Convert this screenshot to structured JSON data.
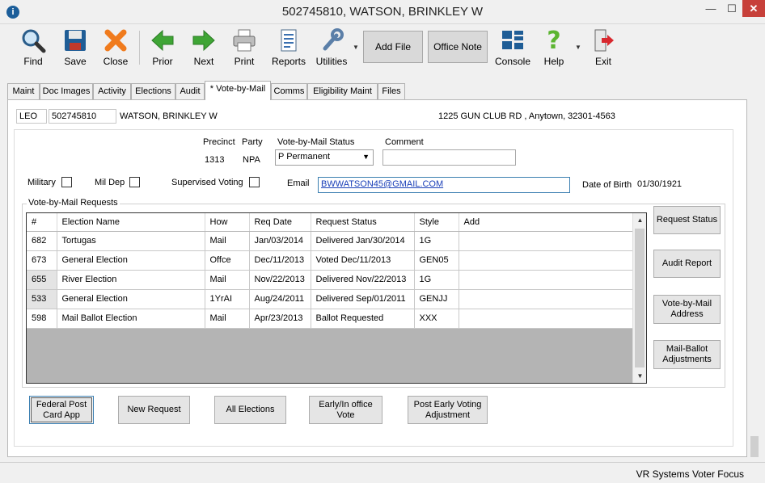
{
  "window": {
    "title": "502745810, WATSON, BRINKLEY W",
    "min": "—",
    "max": "☐",
    "close": "✕"
  },
  "toolbar": {
    "find": "Find",
    "save": "Save",
    "close": "Close",
    "prior": "Prior",
    "next": "Next",
    "print": "Print",
    "reports": "Reports",
    "utilities": "Utilities",
    "add_file": "Add File",
    "office_note": "Office Note",
    "console": "Console",
    "help": "Help",
    "exit": "Exit"
  },
  "tabs": [
    {
      "label": "Maint"
    },
    {
      "label": "Doc Images"
    },
    {
      "label": "Activity"
    },
    {
      "label": "Elections"
    },
    {
      "label": "Audit"
    },
    {
      "label": "* Vote-by-Mail"
    },
    {
      "label": "Comms"
    },
    {
      "label": "Eligibility Maint"
    },
    {
      "label": "Files"
    }
  ],
  "voter": {
    "county": "LEO",
    "id": "502745810",
    "name": "WATSON, BRINKLEY W",
    "address": "1225 GUN CLUB RD , Anytown, 32301-4563"
  },
  "form": {
    "precinct_label": "Precinct",
    "precinct": "1313",
    "party_label": "Party",
    "party": "NPA",
    "status_label": "Vote-by-Mail Status",
    "status": "P Permanent",
    "comment_label": "Comment",
    "comment": "",
    "military_label": "Military",
    "mildep_label": "Mil Dep",
    "supervised_label": "Supervised Voting",
    "email_label": "Email",
    "email": "BWWATSON45@GMAIL.COM",
    "dob_label": "Date of Birth",
    "dob": "01/30/1921"
  },
  "requests": {
    "group_label": "Vote-by-Mail Requests",
    "columns": [
      "#",
      "Election Name",
      "How",
      "Req Date",
      "Request Status",
      "Style",
      "Add"
    ],
    "rows": [
      [
        "682",
        "Tortugas",
        "Mail",
        "Jan/03/2014",
        "Delivered Jan/30/2014",
        "1G",
        ""
      ],
      [
        "673",
        "General Election",
        "Offce",
        "Dec/11/2013",
        "Voted Dec/11/2013",
        "GEN05",
        ""
      ],
      [
        "655",
        "River Election",
        "Mail",
        "Nov/22/2013",
        "Delivered Nov/22/2013",
        "1G",
        ""
      ],
      [
        "533",
        "General Election",
        "1YrAI",
        "Aug/24/2011",
        "Delivered Sep/01/2011",
        "GENJJ",
        ""
      ],
      [
        "598",
        "Mail Ballot Election",
        "Mail",
        "Apr/23/2013",
        "Ballot Requested",
        "XXX",
        ""
      ]
    ]
  },
  "side_buttons": {
    "request_status": "Request Status",
    "audit_report": "Audit Report",
    "vbm_address": "Vote-by-Mail Address",
    "mail_ballot_adj": "Mail-Ballot Adjustments"
  },
  "bottom_buttons": {
    "fpca": "Federal Post Card App",
    "new_request": "New Request",
    "all_elections": "All Elections",
    "early_office": "Early/In office Vote",
    "post_early": "Post Early Voting Adjustment"
  },
  "status": "VR Systems Voter Focus"
}
